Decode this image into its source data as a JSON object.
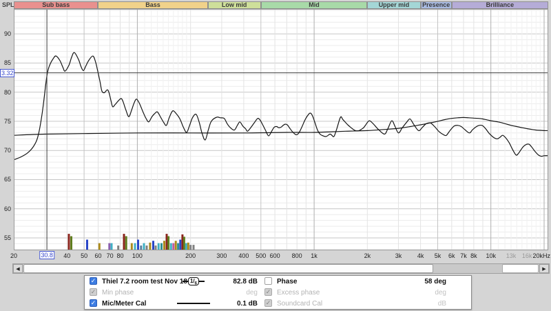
{
  "header": {
    "spl_label": "SPL",
    "bands": [
      {
        "label": "Sub bass",
        "f1": 20,
        "f2": 60,
        "color": "#e9908e"
      },
      {
        "label": "Bass",
        "f1": 60,
        "f2": 250,
        "color": "#f1d28a"
      },
      {
        "label": "Low mid",
        "f1": 250,
        "f2": 500,
        "color": "#cedf9a"
      },
      {
        "label": "Mid",
        "f1": 500,
        "f2": 2000,
        "color": "#a8daa8"
      },
      {
        "label": "Upper mid",
        "f1": 2000,
        "f2": 4000,
        "color": "#a4d6d6"
      },
      {
        "label": "Presence",
        "f1": 4000,
        "f2": 6000,
        "color": "#a8bae1"
      },
      {
        "label": "Brilliance",
        "f1": 6000,
        "f2": 20000,
        "color": "#b5acd7"
      }
    ]
  },
  "chart_data": {
    "type": "line",
    "title": "",
    "x_axis": {
      "scale": "log",
      "min": 20,
      "max": 20000,
      "unit": "Hz",
      "ticks": [
        {
          "f": 20,
          "label": "20"
        },
        {
          "f": 40,
          "label": "40"
        },
        {
          "f": 50,
          "label": "50"
        },
        {
          "f": 60,
          "label": "60"
        },
        {
          "f": 70,
          "label": "70"
        },
        {
          "f": 80,
          "label": "80"
        },
        {
          "f": 100,
          "label": "100"
        },
        {
          "f": 200,
          "label": "200"
        },
        {
          "f": 300,
          "label": "300"
        },
        {
          "f": 400,
          "label": "400"
        },
        {
          "f": 500,
          "label": "500"
        },
        {
          "f": 600,
          "label": "600"
        },
        {
          "f": 800,
          "label": "800"
        },
        {
          "f": 1000,
          "label": "1k"
        },
        {
          "f": 2000,
          "label": "2k"
        },
        {
          "f": 3000,
          "label": "3k"
        },
        {
          "f": 4000,
          "label": "4k"
        },
        {
          "f": 5000,
          "label": "5k"
        },
        {
          "f": 6000,
          "label": "6k"
        },
        {
          "f": 7000,
          "label": "7k"
        },
        {
          "f": 8000,
          "label": "8k"
        },
        {
          "f": 10000,
          "label": "10k"
        },
        {
          "f": 13000,
          "label": "13k",
          "muted": true
        },
        {
          "f": 16000,
          "label": "16k",
          "muted": true
        },
        {
          "f": 20000,
          "label": "20kHz"
        }
      ]
    },
    "y_axis": {
      "label": "SPL",
      "unit": "dB",
      "min": 52.9,
      "max": 94.3,
      "major_ticks": [
        90,
        85,
        80,
        75,
        70,
        65,
        60,
        55
      ]
    },
    "cursor": {
      "freq": 30.8,
      "freq_label": "30.8",
      "level": 83.32,
      "level_label": "3.32"
    },
    "series": [
      {
        "name": "Thiel 7.2 room test Nov 18",
        "color": "#151515",
        "points": [
          [
            20,
            68.4
          ],
          [
            22,
            68.9
          ],
          [
            24,
            69.6
          ],
          [
            26,
            70.8
          ],
          [
            27.5,
            72.6
          ],
          [
            29,
            76.5
          ],
          [
            30.8,
            82.8
          ],
          [
            32,
            84.7
          ],
          [
            33.5,
            85.8
          ],
          [
            34.7,
            86.2
          ],
          [
            36.5,
            85.4
          ],
          [
            38,
            84.2
          ],
          [
            39,
            83.6
          ],
          [
            41,
            84.6
          ],
          [
            42.5,
            86.0
          ],
          [
            44,
            86.8
          ],
          [
            46.5,
            85.6
          ],
          [
            48,
            84.4
          ],
          [
            49.5,
            83.7
          ],
          [
            51,
            84.4
          ],
          [
            53,
            85.4
          ],
          [
            56,
            86.2
          ],
          [
            58,
            85.2
          ],
          [
            60,
            83.3
          ],
          [
            61.5,
            81.8
          ],
          [
            63,
            80.2
          ],
          [
            65,
            79.9
          ],
          [
            67.5,
            80.4
          ],
          [
            69,
            80.0
          ],
          [
            71,
            78.5
          ],
          [
            72.5,
            77.5
          ],
          [
            75,
            77.9
          ],
          [
            78,
            78.5
          ],
          [
            81,
            78.9
          ],
          [
            83,
            78.4
          ],
          [
            86,
            77.0
          ],
          [
            89.5,
            75.8
          ],
          [
            93,
            77.0
          ],
          [
            96,
            78.2
          ],
          [
            99,
            78.8
          ],
          [
            103,
            78.0
          ],
          [
            108,
            76.5
          ],
          [
            112,
            75.5
          ],
          [
            116,
            74.9
          ],
          [
            121,
            75.8
          ],
          [
            126,
            76.4
          ],
          [
            130,
            76.6
          ],
          [
            136,
            75.6
          ],
          [
            141,
            74.8
          ],
          [
            146,
            74.3
          ],
          [
            151,
            75.5
          ],
          [
            156,
            76.5
          ],
          [
            160,
            76.8
          ],
          [
            166,
            76.3
          ],
          [
            171,
            75.8
          ],
          [
            176,
            75.1
          ],
          [
            182,
            74.0
          ],
          [
            190,
            73.1
          ],
          [
            197,
            74.2
          ],
          [
            205,
            75.6
          ],
          [
            215,
            76.2
          ],
          [
            224,
            74.8
          ],
          [
            232,
            73.0
          ],
          [
            242,
            71.8
          ],
          [
            252,
            73.5
          ],
          [
            262,
            75.0
          ],
          [
            281,
            75.7
          ],
          [
            295,
            75.6
          ],
          [
            310,
            75.5
          ],
          [
            322,
            74.6
          ],
          [
            336,
            73.9
          ],
          [
            354,
            73.5
          ],
          [
            368,
            74.3
          ],
          [
            380,
            74.9
          ],
          [
            395,
            74.2
          ],
          [
            410,
            73.7
          ],
          [
            420,
            73.3
          ],
          [
            440,
            74.0
          ],
          [
            460,
            74.8
          ],
          [
            480,
            75.5
          ],
          [
            495,
            75.2
          ],
          [
            510,
            74.5
          ],
          [
            530,
            73.5
          ],
          [
            553,
            72.5
          ],
          [
            575,
            73.3
          ],
          [
            595,
            74.0
          ],
          [
            615,
            74.1
          ],
          [
            630,
            73.9
          ],
          [
            650,
            74.0
          ],
          [
            668,
            74.3
          ],
          [
            685,
            74.5
          ],
          [
            705,
            74.4
          ],
          [
            725,
            73.9
          ],
          [
            755,
            73.2
          ],
          [
            790,
            72.7
          ],
          [
            820,
            73.0
          ],
          [
            855,
            74.1
          ],
          [
            890,
            75.3
          ],
          [
            930,
            76.2
          ],
          [
            955,
            76.4
          ],
          [
            980,
            75.9
          ],
          [
            1010,
            74.8
          ],
          [
            1045,
            73.5
          ],
          [
            1080,
            72.8
          ],
          [
            1125,
            72.5
          ],
          [
            1170,
            72.4
          ],
          [
            1230,
            72.8
          ],
          [
            1260,
            72.6
          ],
          [
            1295,
            72.4
          ],
          [
            1340,
            73.6
          ],
          [
            1410,
            75.7
          ],
          [
            1455,
            75.3
          ],
          [
            1550,
            74.4
          ],
          [
            1650,
            73.7
          ],
          [
            1715,
            73.4
          ],
          [
            1790,
            73.4
          ],
          [
            1845,
            73.6
          ],
          [
            1905,
            73.9
          ],
          [
            1960,
            74.4
          ],
          [
            2050,
            75.1
          ],
          [
            2155,
            74.6
          ],
          [
            2310,
            73.6
          ],
          [
            2500,
            72.8
          ],
          [
            2610,
            73.7
          ],
          [
            2750,
            75.1
          ],
          [
            2870,
            74.1
          ],
          [
            3000,
            73.0
          ],
          [
            3155,
            73.9
          ],
          [
            3350,
            74.9
          ],
          [
            3490,
            75.4
          ],
          [
            3655,
            74.5
          ],
          [
            3900,
            73.4
          ],
          [
            4105,
            74.0
          ],
          [
            4310,
            74.6
          ],
          [
            4560,
            74.7
          ],
          [
            4800,
            74.1
          ],
          [
            5100,
            73.2
          ],
          [
            5400,
            72.7
          ],
          [
            5600,
            72.6
          ],
          [
            5900,
            73.5
          ],
          [
            6200,
            74.2
          ],
          [
            6500,
            74.3
          ],
          [
            6800,
            74.1
          ],
          [
            7100,
            73.6
          ],
          [
            7560,
            73.0
          ],
          [
            7900,
            73.6
          ],
          [
            8400,
            74.2
          ],
          [
            8900,
            74.3
          ],
          [
            9300,
            73.8
          ],
          [
            9800,
            72.9
          ],
          [
            10400,
            72.2
          ],
          [
            10900,
            72.0
          ],
          [
            11300,
            72.3
          ],
          [
            11650,
            72.6
          ],
          [
            12100,
            72.2
          ],
          [
            12700,
            71.3
          ],
          [
            13300,
            70.1
          ],
          [
            13900,
            69.2
          ],
          [
            14400,
            69.6
          ],
          [
            15300,
            70.7
          ],
          [
            16300,
            71.1
          ],
          [
            17000,
            70.6
          ],
          [
            17800,
            69.8
          ],
          [
            18600,
            69.2
          ],
          [
            19300,
            69.0
          ],
          [
            20000,
            69.1
          ]
        ]
      },
      {
        "name": "Mic/Meter Cal",
        "color": "#151515",
        "points": [
          [
            20,
            72.6
          ],
          [
            30,
            72.8
          ],
          [
            50,
            72.9
          ],
          [
            100,
            73.0
          ],
          [
            200,
            73.0
          ],
          [
            400,
            73.0
          ],
          [
            700,
            73.1
          ],
          [
            1000,
            73.1
          ],
          [
            1500,
            73.3
          ],
          [
            2000,
            73.4
          ],
          [
            2500,
            73.6
          ],
          [
            3000,
            73.8
          ],
          [
            3500,
            74.1
          ],
          [
            4000,
            74.4
          ],
          [
            4500,
            74.7
          ],
          [
            5000,
            75.0
          ],
          [
            5500,
            75.3
          ],
          [
            6000,
            75.5
          ],
          [
            6500,
            75.6
          ],
          [
            7000,
            75.65
          ],
          [
            7500,
            75.6
          ],
          [
            8000,
            75.55
          ],
          [
            8500,
            75.5
          ],
          [
            9000,
            75.4
          ],
          [
            9500,
            75.25
          ],
          [
            10000,
            75.1
          ],
          [
            11000,
            74.9
          ],
          [
            12000,
            74.6
          ],
          [
            13000,
            74.3
          ],
          [
            14000,
            74.1
          ],
          [
            15000,
            73.9
          ],
          [
            16000,
            73.75
          ],
          [
            17000,
            73.6
          ],
          [
            18000,
            73.5
          ],
          [
            19000,
            73.45
          ],
          [
            20000,
            73.4
          ]
        ]
      }
    ],
    "bars": [
      [
        41,
        55.7,
        "#8a241c"
      ],
      [
        42.3,
        55.3,
        "#5f7d1f"
      ],
      [
        52,
        54.7,
        "#2a46c8"
      ],
      [
        61,
        54.1,
        "#ab8b1d"
      ],
      [
        69.5,
        54.1,
        "#8a5fae"
      ],
      [
        71.5,
        54.1,
        "#3fb0c4"
      ],
      [
        78,
        53.7,
        "#808080"
      ],
      [
        84,
        55.7,
        "#8a241c"
      ],
      [
        86.5,
        55.3,
        "#5f7d1f"
      ],
      [
        93,
        54.1,
        "#ab8b1d"
      ],
      [
        97,
        54.1,
        "#3fb0c4"
      ],
      [
        101,
        54.7,
        "#2a46c8"
      ],
      [
        105,
        53.7,
        "#5b7f9e"
      ],
      [
        109,
        54.1,
        "#3fb0c4"
      ],
      [
        113,
        53.7,
        "#808080"
      ],
      [
        118,
        54.2,
        "#ab8b1d"
      ],
      [
        123,
        54.5,
        "#2a46c8"
      ],
      [
        127,
        53.7,
        "#808080"
      ],
      [
        132,
        54.1,
        "#3fb0c4"
      ],
      [
        137,
        54.1,
        "#2e8f8f"
      ],
      [
        142,
        54.5,
        "#ab8b1d"
      ],
      [
        146.5,
        55.7,
        "#8a241c"
      ],
      [
        150,
        55.3,
        "#5f7d1f"
      ],
      [
        155,
        54.1,
        "#3fb0c4"
      ],
      [
        160,
        54.1,
        "#c05a9e"
      ],
      [
        165,
        54.5,
        "#ab8b1d"
      ],
      [
        170,
        54.1,
        "#2e8f8f"
      ],
      [
        175,
        54.7,
        "#2a46c8"
      ],
      [
        180,
        55.6,
        "#8a241c"
      ],
      [
        184,
        55.2,
        "#5f7d1f"
      ],
      [
        189,
        54.1,
        "#3fb0c4"
      ],
      [
        194,
        54.2,
        "#ab8b1d"
      ],
      [
        200,
        53.8,
        "#808080"
      ],
      [
        208,
        53.8,
        "#808080"
      ]
    ]
  },
  "scrollbar": {
    "left_arrow": "◀",
    "right_arrow": "▶"
  },
  "legend": {
    "rows": [
      {
        "left": {
          "check": "blue",
          "label": "Thiel 7.2 room test Nov 18",
          "symbol": "smoothing",
          "smoothing_text": "1/",
          "smoothing_sub": "6",
          "value": "82.8 dB",
          "dark": true
        },
        "right": {
          "check": "empty",
          "label": "Phase",
          "value": "58 deg",
          "dark": true
        }
      },
      {
        "left": {
          "check": "gray",
          "label": "Min phase",
          "symbol": "none",
          "value": "deg",
          "dark": false
        },
        "right": {
          "check": "gray",
          "label": "Excess phase",
          "value": "deg",
          "dark": false
        }
      },
      {
        "left": {
          "check": "blue",
          "label": "Mic/Meter Cal",
          "symbol": "line",
          "value": "0.1 dB",
          "dark": true
        },
        "right": {
          "check": "gray",
          "label": "Soundcard Cal",
          "value": "dB",
          "dark": false
        }
      }
    ],
    "check_glyph": "✓"
  }
}
